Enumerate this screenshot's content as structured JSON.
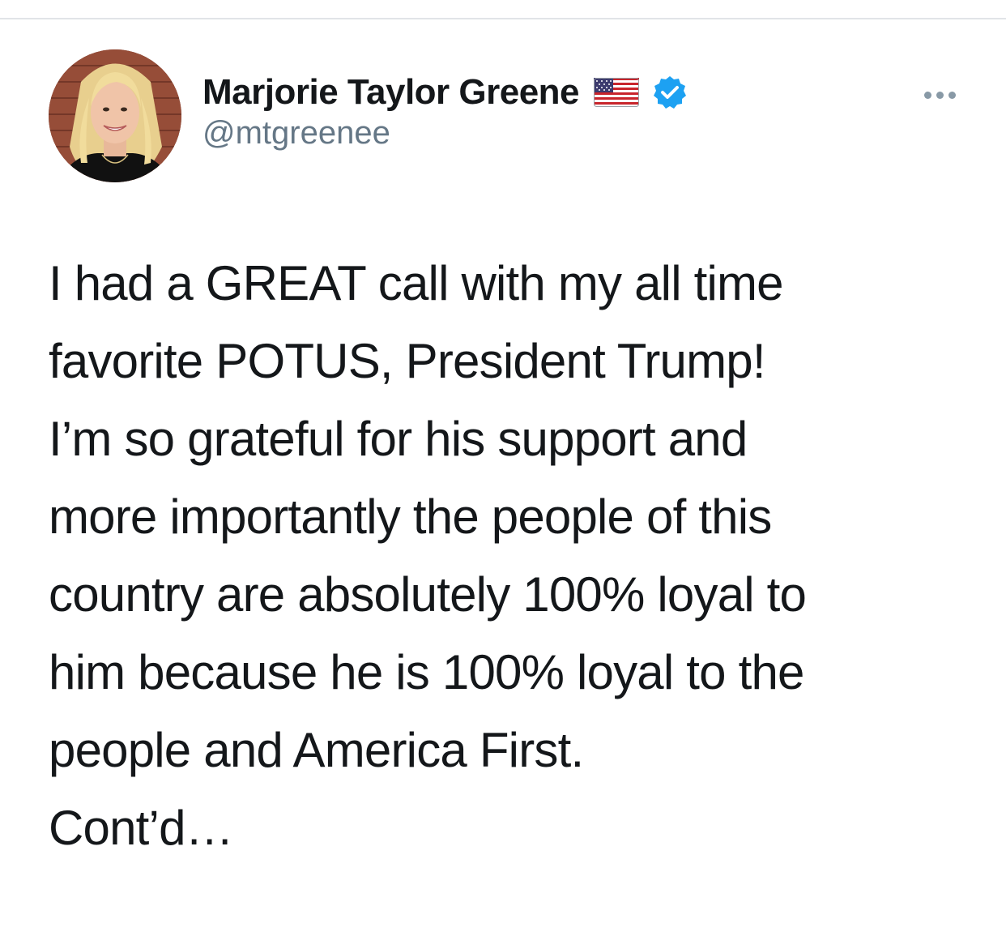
{
  "author": {
    "name": "Marjorie Taylor Greene",
    "handle": "@mtgreenee",
    "flag_icon": "us-flag-emoji",
    "verified_icon": "verified-badge",
    "verified_color": "#1da1f2"
  },
  "menu": {
    "icon": "more-options-icon"
  },
  "tweet": {
    "paragraphs": [
      "I had a GREAT call with my all time\nfavorite POTUS, President Trump!",
      "I’m so grateful for his support and\nmore importantly the people of this\ncountry are absolutely 100% loyal to\nhim because he is 100% loyal to the\npeople and America First.",
      "Cont’d…"
    ]
  }
}
